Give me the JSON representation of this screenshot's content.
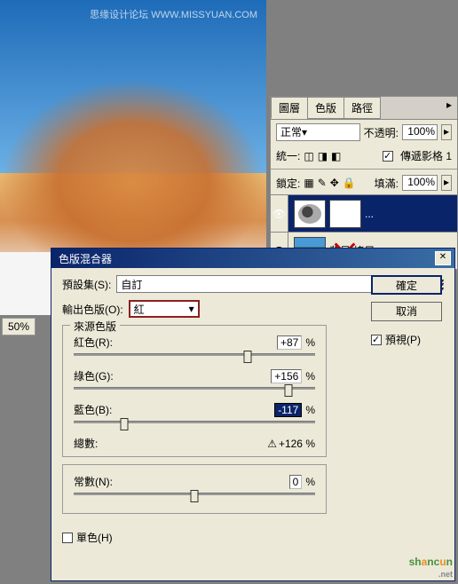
{
  "photo": {
    "watermark": "思缘设计论坛  WWW.MISSYUAN.COM",
    "zoom": "50%"
  },
  "layers_panel": {
    "tabs": [
      "圖層",
      "色版",
      "路徑"
    ],
    "blend_mode": "正常",
    "opacity_label": "不透明:",
    "opacity_value": "100%",
    "unify_label": "統一:",
    "propagate_label": "傳遞影格 1",
    "lock_label": "鎖定:",
    "fill_label": "填滿:",
    "fill_value": "100%",
    "layer_dots": "...",
    "bg_layer": "背見 拷目"
  },
  "dialog": {
    "title": "色版混合器",
    "preset_label": "預設集(S):",
    "preset_value": "自訂",
    "output_label": "輸出色版(O):",
    "output_value": "紅",
    "source_fieldset": "來源色版",
    "red_label": "紅色(R):",
    "red_value": "+87",
    "green_label": "綠色(G):",
    "green_value": "+156",
    "blue_label": "藍色(B):",
    "blue_value": "-117",
    "total_label": "總數:",
    "total_value": "+126",
    "constant_label": "常數(N):",
    "constant_value": "0",
    "mono_label": "單色(H)",
    "ok_btn": "確定",
    "cancel_btn": "取消",
    "preview_label": "預視(P)",
    "pct": "%"
  },
  "logo": {
    "text1": "sh",
    "text2": "a",
    "text3": "nc",
    "text4": "u",
    "text5": "n",
    "net": ".net"
  }
}
